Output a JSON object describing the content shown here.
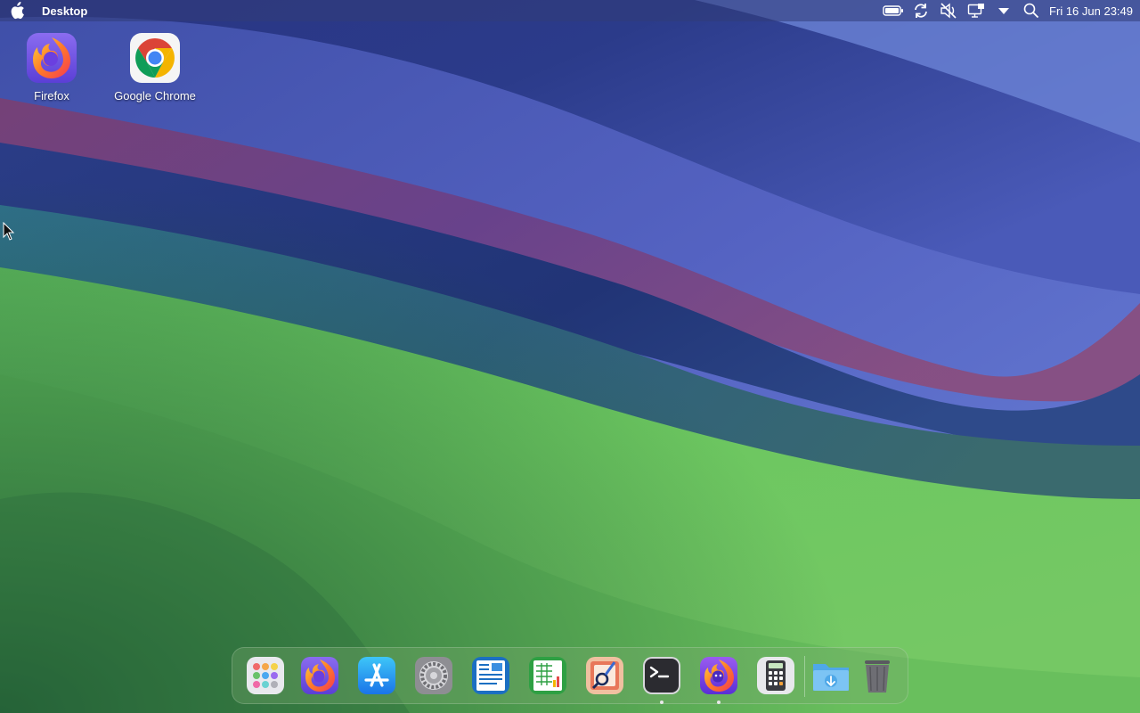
{
  "menubar": {
    "app_name": "Desktop",
    "clock": "Fri 16 Jun 23:49",
    "tray_icons": [
      "battery-icon",
      "sync-icon",
      "volume-muted-icon",
      "display-icon",
      "dropdown-arrow-icon",
      "search-icon"
    ]
  },
  "desktop_icons": [
    {
      "label": "Firefox",
      "icon": "firefox-icon"
    },
    {
      "label": "Google Chrome",
      "icon": "google-chrome-icon"
    }
  ],
  "dock": {
    "items": [
      {
        "icon": "launchpad-icon",
        "running": false
      },
      {
        "icon": "firefox-icon",
        "running": false
      },
      {
        "icon": "app-store-icon",
        "running": false
      },
      {
        "icon": "system-settings-icon",
        "running": false
      },
      {
        "icon": "document-writer-icon",
        "running": false
      },
      {
        "icon": "spreadsheet-icon",
        "running": false
      },
      {
        "icon": "image-viewer-icon",
        "running": false
      },
      {
        "icon": "terminal-icon",
        "running": true
      },
      {
        "icon": "firefox-dev-icon",
        "running": true
      },
      {
        "icon": "calculator-icon",
        "running": false
      },
      {
        "icon": "downloads-folder-icon",
        "running": false
      },
      {
        "icon": "trash-icon",
        "running": false
      }
    ]
  },
  "colors": {
    "sky_top": "#4b5fb8",
    "ribbon_navy": "#22307a",
    "ribbon_magenta": "#8a4a7a",
    "hill_green": "#6dc65e",
    "hill_dark": "#2e7f4c"
  }
}
